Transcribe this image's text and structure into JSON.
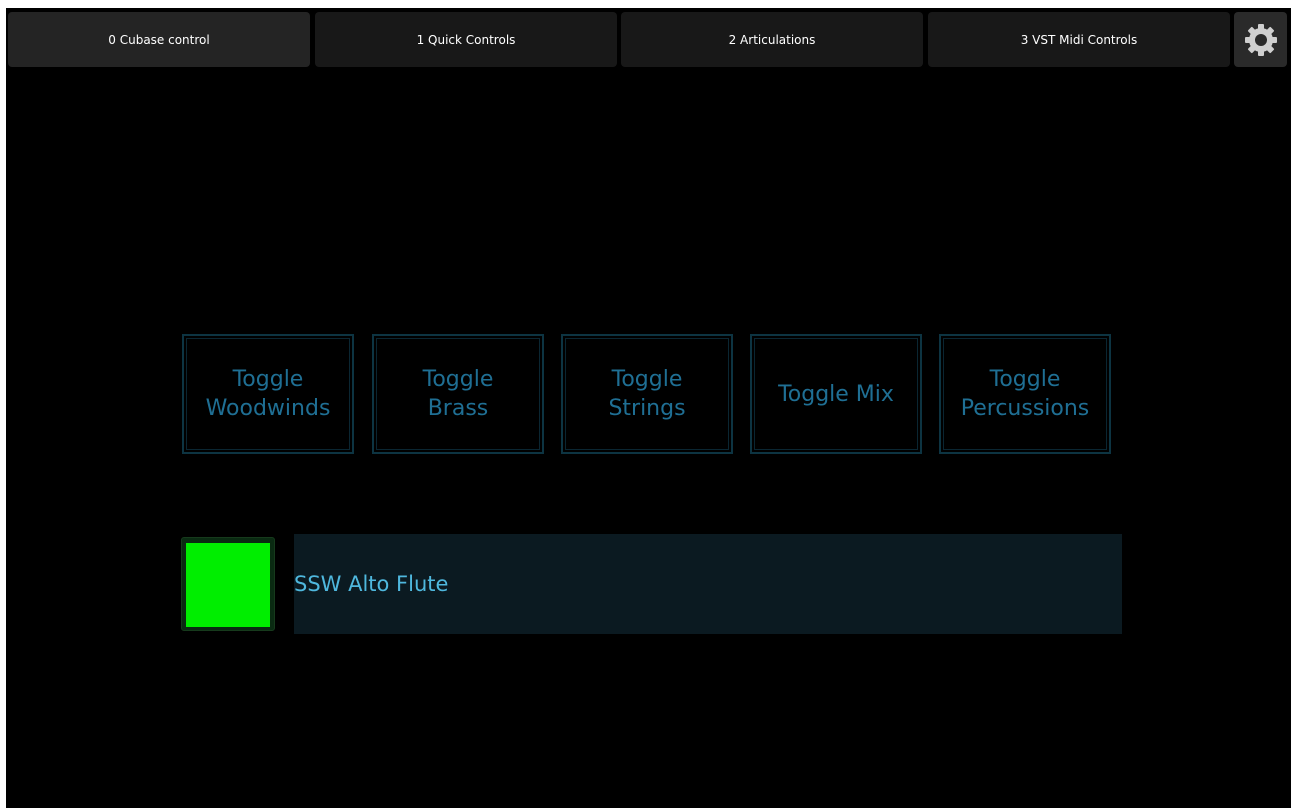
{
  "tabs": [
    {
      "label": "0 Cubase control",
      "active": true
    },
    {
      "label": "1 Quick Controls",
      "active": false
    },
    {
      "label": "2 Articulations",
      "active": false
    },
    {
      "label": "3 VST Midi Controls",
      "active": false
    }
  ],
  "settings_icon": "gear-icon",
  "toggles": [
    {
      "label": "Toggle\nWoodwinds"
    },
    {
      "label": "Toggle\nBrass"
    },
    {
      "label": "Toggle\nStrings"
    },
    {
      "label": "Toggle Mix"
    },
    {
      "label": "Toggle\nPercussions"
    }
  ],
  "track": {
    "name": "SSW Alto Flute",
    "indicator_color": "#00ee00"
  },
  "colors": {
    "background": "#000000",
    "toggle_text": "#1f6f94",
    "track_text": "#4fb8de"
  }
}
